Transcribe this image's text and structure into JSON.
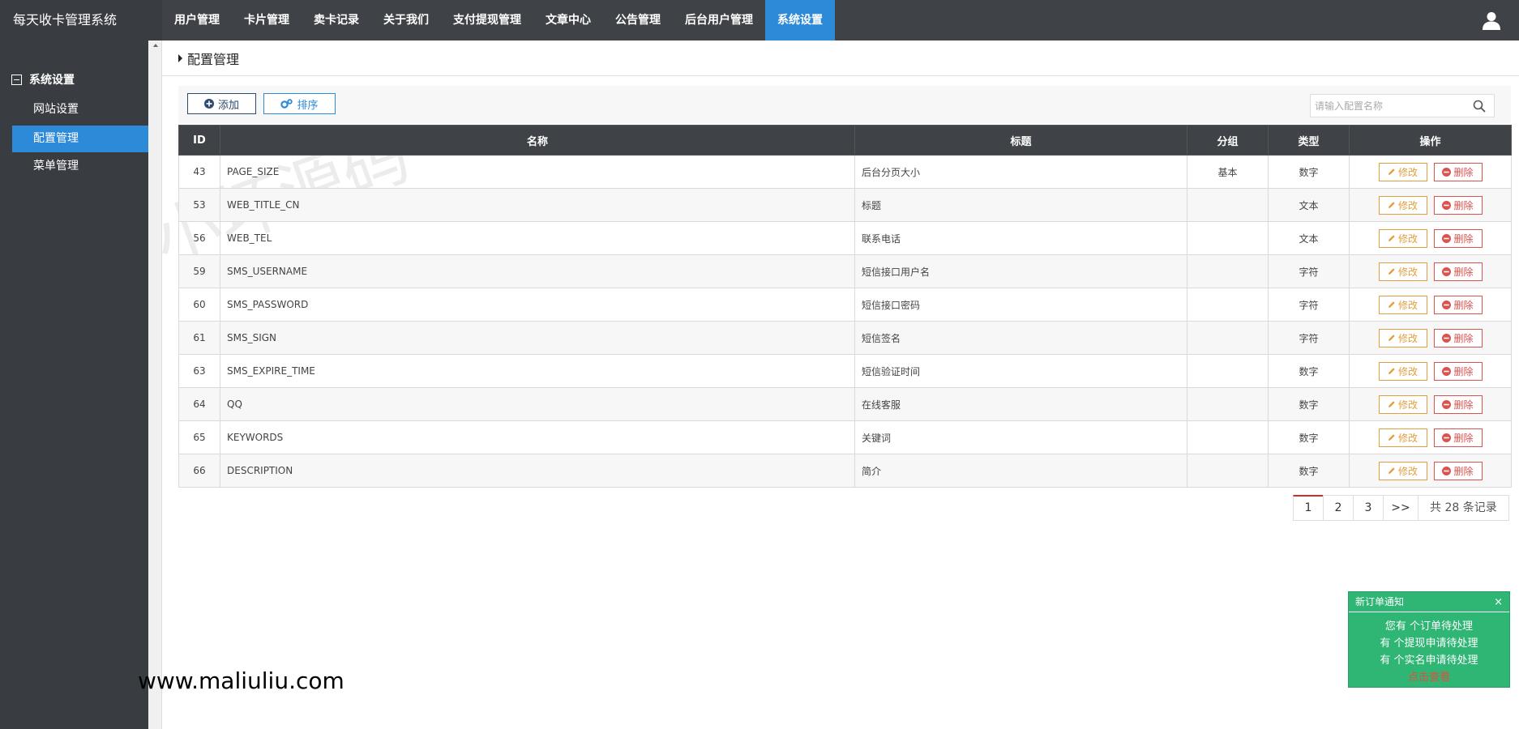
{
  "app": {
    "title": "每天收卡管理系统"
  },
  "nav": {
    "items": [
      {
        "label": "用户管理"
      },
      {
        "label": "卡片管理"
      },
      {
        "label": "卖卡记录"
      },
      {
        "label": "关于我们"
      },
      {
        "label": "支付提现管理"
      },
      {
        "label": "文章中心"
      },
      {
        "label": "公告管理"
      },
      {
        "label": "后台用户管理"
      },
      {
        "label": "系统设置",
        "active": true
      }
    ]
  },
  "sidebar": {
    "group": "系统设置",
    "items": [
      {
        "label": "网站设置"
      },
      {
        "label": "配置管理",
        "active": true
      },
      {
        "label": "菜单管理"
      }
    ]
  },
  "page": {
    "title": "配置管理"
  },
  "toolbar": {
    "add_label": "添加",
    "sort_label": "排序",
    "search_placeholder": "请输入配置名称"
  },
  "table": {
    "headers": [
      "ID",
      "名称",
      "标题",
      "分组",
      "类型",
      "操作"
    ],
    "edit_label": "修改",
    "delete_label": "删除",
    "rows": [
      {
        "id": "43",
        "name": "PAGE_SIZE",
        "title": "后台分页大小",
        "group": "基本",
        "type": "数字"
      },
      {
        "id": "53",
        "name": "WEB_TITLE_CN",
        "title": "标题",
        "group": "",
        "type": "文本"
      },
      {
        "id": "56",
        "name": "WEB_TEL",
        "title": "联系电话",
        "group": "",
        "type": "文本"
      },
      {
        "id": "59",
        "name": "SMS_USERNAME",
        "title": "短信接口用户名",
        "group": "",
        "type": "字符"
      },
      {
        "id": "60",
        "name": "SMS_PASSWORD",
        "title": "短信接口密码",
        "group": "",
        "type": "字符"
      },
      {
        "id": "61",
        "name": "SMS_SIGN",
        "title": "短信签名",
        "group": "",
        "type": "字符"
      },
      {
        "id": "63",
        "name": "SMS_EXPIRE_TIME",
        "title": "短信验证时间",
        "group": "",
        "type": "数字"
      },
      {
        "id": "64",
        "name": "QQ",
        "title": "在线客服",
        "group": "",
        "type": "数字"
      },
      {
        "id": "65",
        "name": "KEYWORDS",
        "title": "关键词",
        "group": "",
        "type": "数字"
      },
      {
        "id": "66",
        "name": "DESCRIPTION",
        "title": "简介",
        "group": "",
        "type": "数字"
      }
    ]
  },
  "pagination": {
    "pages": [
      "1",
      "2",
      "3"
    ],
    "current": "1",
    "next": ">>",
    "total": "共 28 条记录"
  },
  "watermark": {
    "text": "小坏源码",
    "url": "www.maliuliu.com"
  },
  "notification": {
    "title": "新订单通知",
    "close": "×",
    "line1": "您有 个订单待处理",
    "line2": "有 个提现申请待处理",
    "line3": "有 个实名申请待处理",
    "link": "点击查看"
  },
  "colors": {
    "topbar": "#3f4246",
    "sidebar": "#393d41",
    "accent": "#2d8ad9",
    "notify": "#2fb574",
    "edit": "#e0a040",
    "delete": "#d9534f"
  }
}
